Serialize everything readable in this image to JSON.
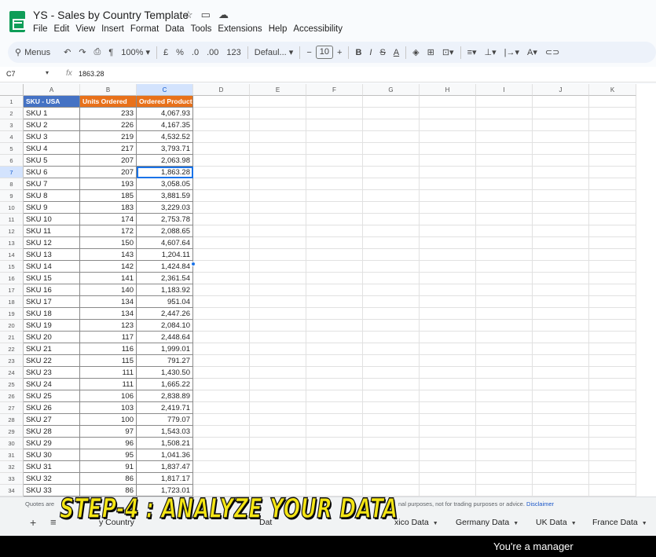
{
  "window": {
    "doc_title": "YS - Sales by Country Template",
    "menu": [
      "File",
      "Edit",
      "View",
      "Insert",
      "Format",
      "Data",
      "Tools",
      "Extensions",
      "Help",
      "Accessibility"
    ]
  },
  "toolbar": {
    "search_label": "Menus",
    "zoom": "100%",
    "currency": "£",
    "percent": "%",
    "dec_decrease": ".0",
    "dec_increase": ".00",
    "number_format": "123",
    "font": "Defaul...",
    "font_size": "10",
    "bold": "B",
    "italic": "I",
    "strike": "S",
    "text_color": "A"
  },
  "formula_bar": {
    "cell_ref": "C7",
    "fx": "fx",
    "value": "1863.28"
  },
  "grid": {
    "columns": [
      "A",
      "B",
      "C",
      "D",
      "E",
      "F",
      "G",
      "H",
      "I",
      "J",
      "K"
    ],
    "selected_column": "C",
    "selected_row": 7,
    "headers": [
      "SKU - USA",
      "Units Ordered",
      "Ordered Product"
    ],
    "rows": [
      {
        "num": "2",
        "sku": "SKU 1",
        "units": "233",
        "sales": "4,067.93"
      },
      {
        "num": "3",
        "sku": "SKU 2",
        "units": "226",
        "sales": "4,167.35"
      },
      {
        "num": "4",
        "sku": "SKU 3",
        "units": "219",
        "sales": "4,532.52"
      },
      {
        "num": "5",
        "sku": "SKU 4",
        "units": "217",
        "sales": "3,793.71"
      },
      {
        "num": "6",
        "sku": "SKU 5",
        "units": "207",
        "sales": "2,063.98"
      },
      {
        "num": "7",
        "sku": "SKU 6",
        "units": "207",
        "sales": "1,863.28"
      },
      {
        "num": "8",
        "sku": "SKU 7",
        "units": "193",
        "sales": "3,058.05"
      },
      {
        "num": "9",
        "sku": "SKU 8",
        "units": "185",
        "sales": "3,881.59"
      },
      {
        "num": "10",
        "sku": "SKU 9",
        "units": "183",
        "sales": "3,229.03"
      },
      {
        "num": "11",
        "sku": "SKU 10",
        "units": "174",
        "sales": "2,753.78"
      },
      {
        "num": "12",
        "sku": "SKU 11",
        "units": "172",
        "sales": "2,088.65"
      },
      {
        "num": "13",
        "sku": "SKU 12",
        "units": "150",
        "sales": "4,607.64"
      },
      {
        "num": "14",
        "sku": "SKU 13",
        "units": "143",
        "sales": "1,204.11"
      },
      {
        "num": "15",
        "sku": "SKU 14",
        "units": "142",
        "sales": "1,424.84"
      },
      {
        "num": "16",
        "sku": "SKU 15",
        "units": "141",
        "sales": "2,361.54"
      },
      {
        "num": "17",
        "sku": "SKU 16",
        "units": "140",
        "sales": "1,183.92"
      },
      {
        "num": "18",
        "sku": "SKU 17",
        "units": "134",
        "sales": "951.04"
      },
      {
        "num": "19",
        "sku": "SKU 18",
        "units": "134",
        "sales": "2,447.26"
      },
      {
        "num": "20",
        "sku": "SKU 19",
        "units": "123",
        "sales": "2,084.10"
      },
      {
        "num": "21",
        "sku": "SKU 20",
        "units": "117",
        "sales": "2,448.64"
      },
      {
        "num": "22",
        "sku": "SKU 21",
        "units": "116",
        "sales": "1,999.01"
      },
      {
        "num": "23",
        "sku": "SKU 22",
        "units": "115",
        "sales": "791.27"
      },
      {
        "num": "24",
        "sku": "SKU 23",
        "units": "111",
        "sales": "1,430.50"
      },
      {
        "num": "25",
        "sku": "SKU 24",
        "units": "111",
        "sales": "1,665.22"
      },
      {
        "num": "26",
        "sku": "SKU 25",
        "units": "106",
        "sales": "2,838.89"
      },
      {
        "num": "27",
        "sku": "SKU 26",
        "units": "103",
        "sales": "2,419.71"
      },
      {
        "num": "28",
        "sku": "SKU 27",
        "units": "100",
        "sales": "779.07"
      },
      {
        "num": "29",
        "sku": "SKU 28",
        "units": "97",
        "sales": "1,543.03"
      },
      {
        "num": "30",
        "sku": "SKU 29",
        "units": "96",
        "sales": "1,508.21"
      },
      {
        "num": "31",
        "sku": "SKU 30",
        "units": "95",
        "sales": "1,041.36"
      },
      {
        "num": "32",
        "sku": "SKU 31",
        "units": "91",
        "sales": "1,837.47"
      },
      {
        "num": "33",
        "sku": "SKU 32",
        "units": "86",
        "sales": "1,817.17"
      },
      {
        "num": "34",
        "sku": "SKU 33",
        "units": "86",
        "sales": "1,723.01"
      }
    ]
  },
  "disclaimer": {
    "left": "Quotes are",
    "right": "nal purposes, not for trading purposes or advice.",
    "link": "Disclaimer"
  },
  "tabs": [
    {
      "label": "y Country"
    },
    {
      "label": "Dat"
    },
    {
      "label": "xico Data"
    },
    {
      "label": "Germany Data"
    },
    {
      "label": "UK Data"
    },
    {
      "label": "France Data"
    }
  ],
  "overlay": {
    "caption": "STEP-4 : ANALYZE YOUR DATA",
    "subtitle": "You're a manager"
  },
  "colors": {
    "header_blue": "#4472c4",
    "header_orange": "#e8711a",
    "selection": "#1a73e8",
    "caption_yellow": "#f5e614"
  },
  "icons": [
    "sheets-logo-icon",
    "star-icon",
    "folder-icon",
    "cloud-icon",
    "search-icon",
    "undo-icon",
    "redo-icon",
    "print-icon",
    "paint-format-icon",
    "fill-color-icon",
    "borders-icon",
    "merge-icon",
    "align-icon",
    "valign-icon",
    "wrap-icon",
    "rotate-icon",
    "link-icon"
  ]
}
